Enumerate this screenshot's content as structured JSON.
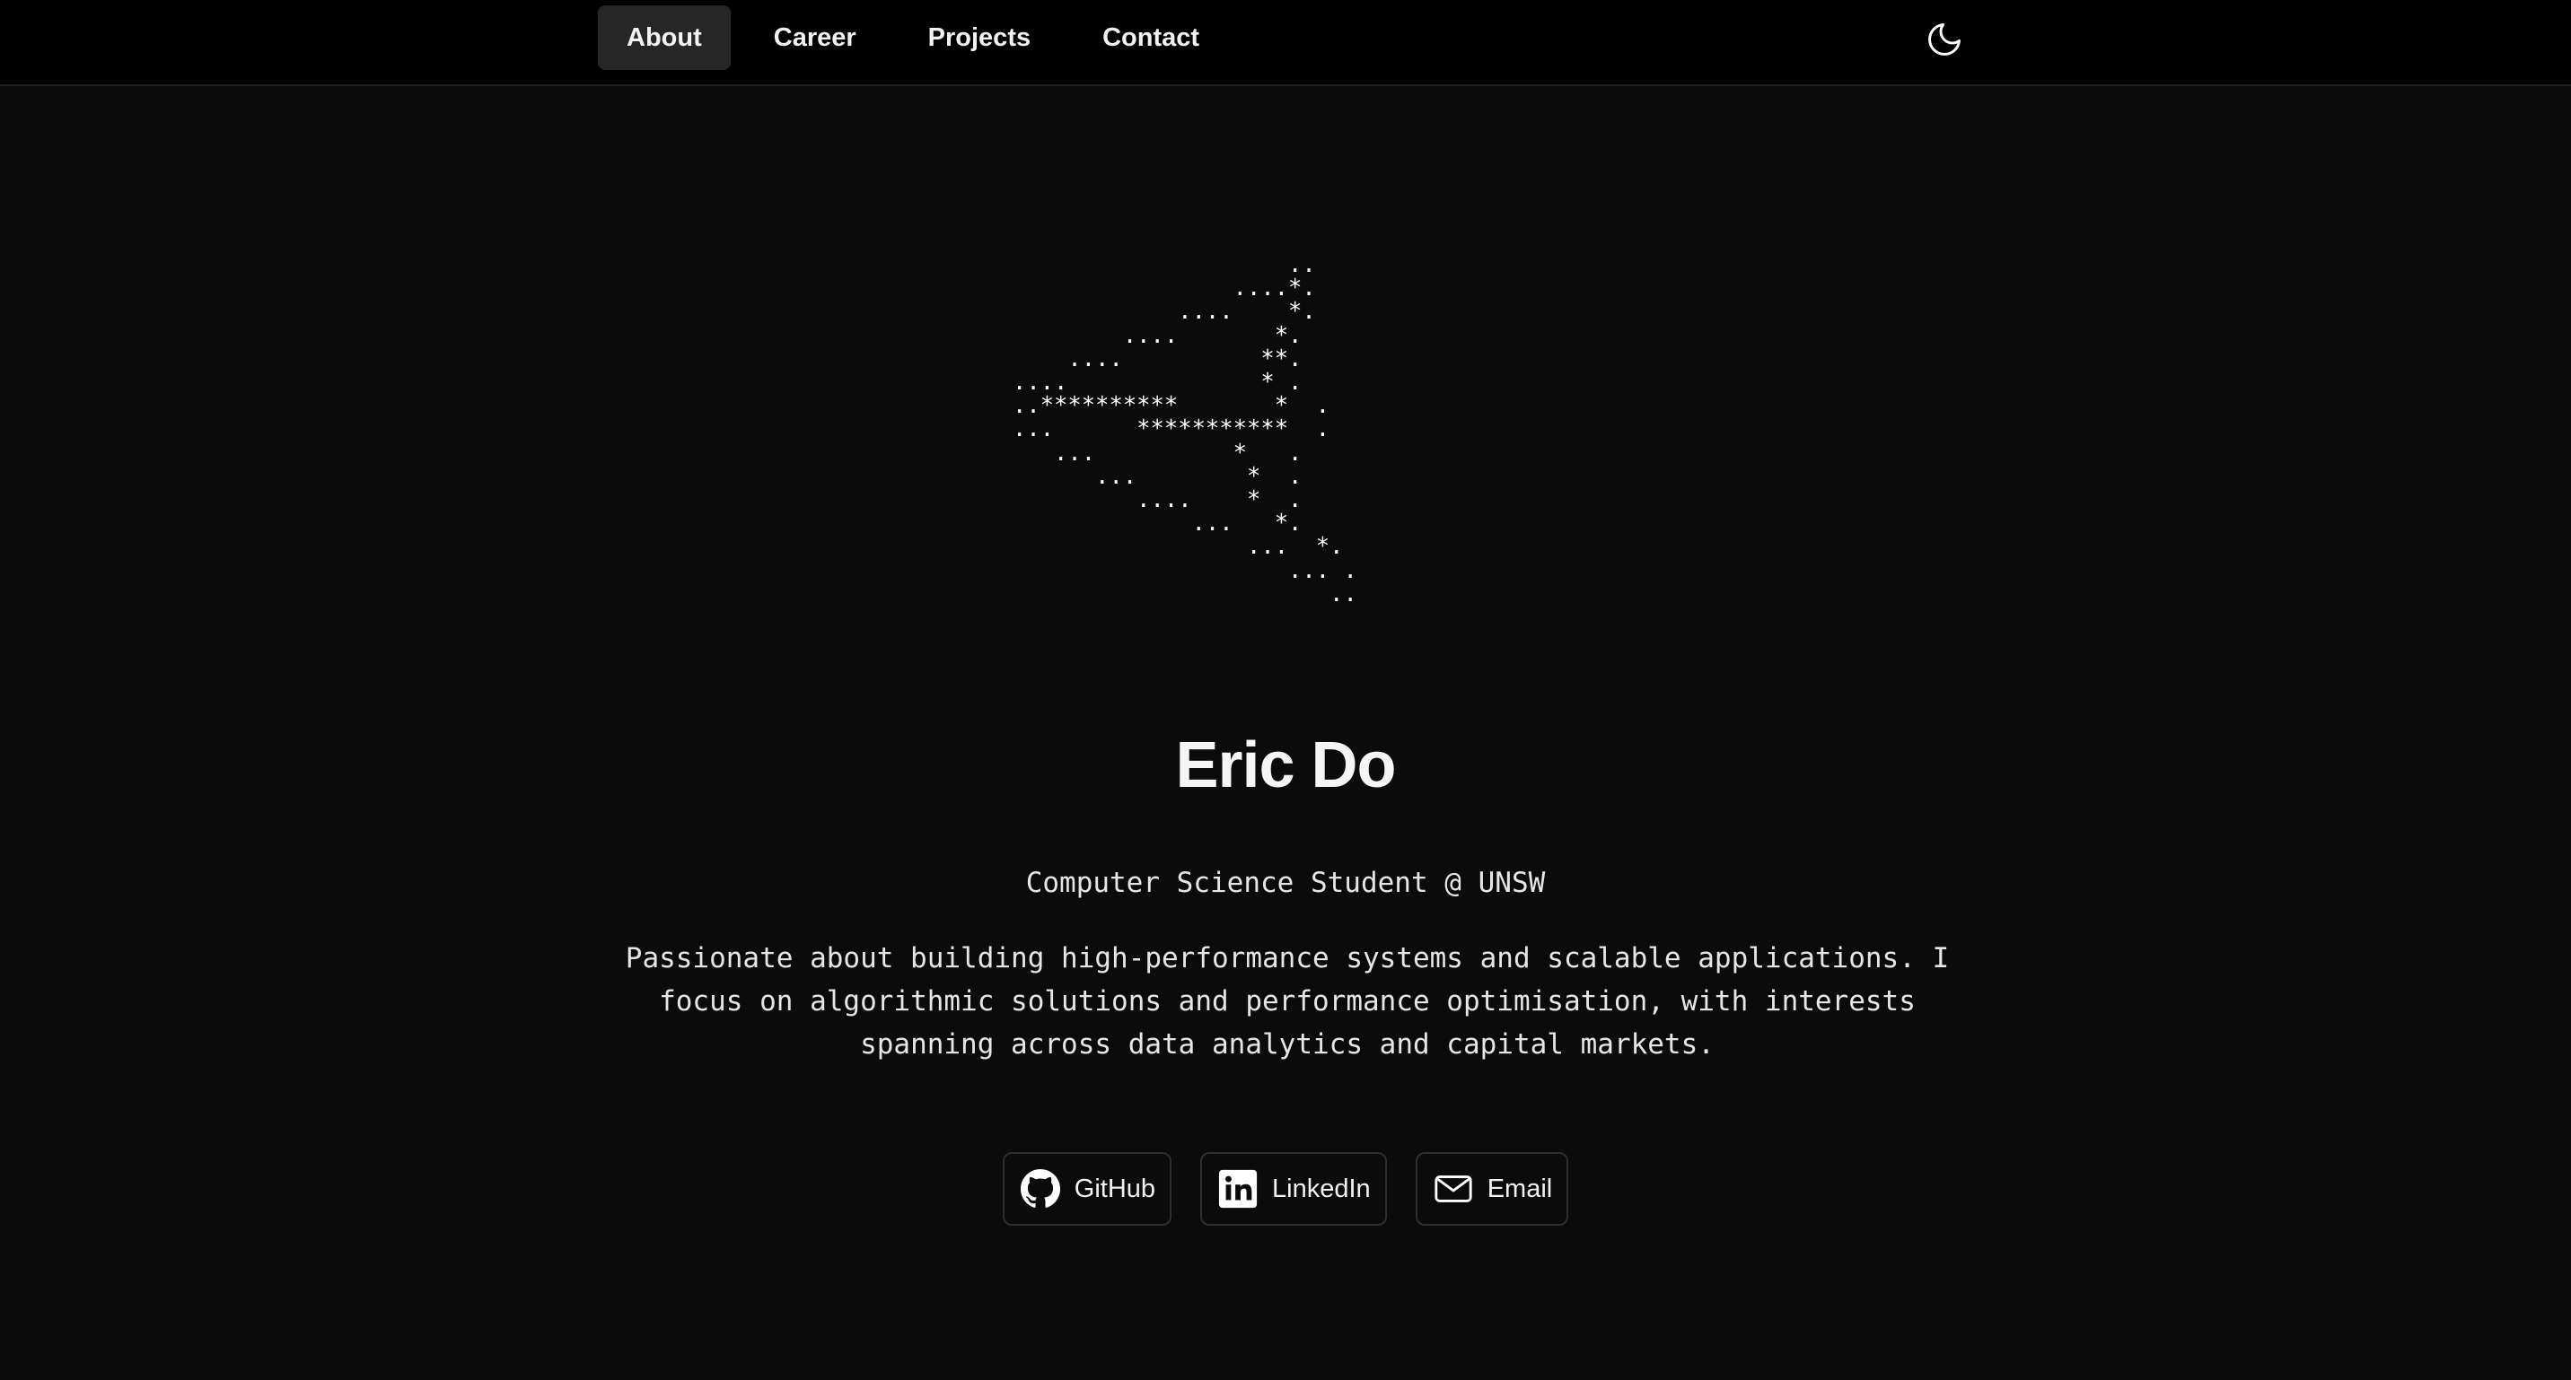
{
  "nav": {
    "items": [
      {
        "label": "About",
        "active": true
      },
      {
        "label": "Career",
        "active": false
      },
      {
        "label": "Projects",
        "active": false
      },
      {
        "label": "Contact",
        "active": false
      }
    ],
    "theme_toggle_icon": "moon-icon"
  },
  "hero": {
    "ascii_art": "                    ..\n                ....*.\n            ....    *.\n        ....       *.\n    ....          **.\n....              * .\n..**********       *  .\n...      ***********  .\n   ...          *   .\n      ...        *  .\n         ....    *  .\n             ...   *.\n                 ...  *.\n                    ... .\n                       ..",
    "name": "Eric Do",
    "subtitle": "Computer Science Student @ UNSW",
    "bio": "Passionate about building high-performance systems and scalable applications. I focus on algorithmic solutions and performance optimisation, with interests spanning across data analytics and capital markets."
  },
  "links": [
    {
      "label": "GitHub",
      "icon": "github-icon"
    },
    {
      "label": "LinkedIn",
      "icon": "linkedin-icon"
    },
    {
      "label": "Email",
      "icon": "mail-icon"
    }
  ],
  "colors": {
    "background": "#0b0b0b",
    "topbar": "#000000",
    "active_nav": "#262626",
    "text": "#ffffff"
  }
}
